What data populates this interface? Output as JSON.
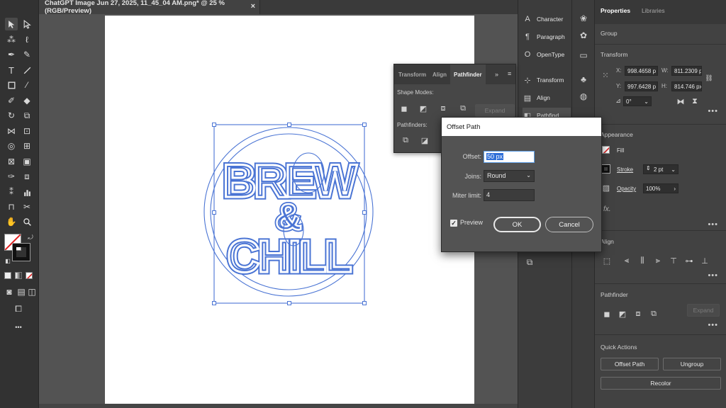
{
  "document": {
    "tab_title": "ChatGPT Image Jun 27, 2025, 11_45_04 AM.png* @ 25 % (RGB/Preview)",
    "close_glyph": "×"
  },
  "toolbar": {
    "tools": [
      "selection-tool",
      "direct-selection-tool",
      "magic-wand-tool",
      "lasso-tool",
      "pen-tool",
      "curvature-tool",
      "type-tool",
      "line-tool",
      "rectangle-tool",
      "paintbrush-tool",
      "shaper-tool",
      "eraser-tool",
      "rotate-tool",
      "scale-tool",
      "width-tool",
      "free-transform-tool",
      "shape-builder-tool",
      "perspective-grid-tool",
      "mesh-tool",
      "gradient-tool",
      "eyedropper-tool",
      "blend-tool",
      "symbol-sprayer-tool",
      "column-graph-tool",
      "artboard-tool",
      "slice-tool",
      "hand-tool",
      "zoom-tool"
    ],
    "more_glyph": "•••"
  },
  "mid_dock": {
    "items": [
      "Character",
      "Paragraph",
      "OpenType",
      "Transform",
      "Align",
      "Pathfind..."
    ]
  },
  "properties": {
    "tabs": [
      "Properties",
      "Libraries"
    ],
    "selection_type": "Group",
    "transform": {
      "title": "Transform",
      "x_label": "X:",
      "x": "998.4658 p",
      "y_label": "Y:",
      "y": "997.6428 p",
      "w_label": "W:",
      "w": "811.2309 p",
      "h_label": "H:",
      "h": "814.746 px",
      "angle": "0°"
    },
    "appearance": {
      "title": "Appearance",
      "fill_label": "Fill",
      "stroke_label": "Stroke",
      "stroke_weight": "2 pt",
      "opacity_label": "Opacity",
      "opacity": "100%",
      "fx": "fx."
    },
    "align": {
      "title": "Align"
    },
    "pathfinder": {
      "title": "Pathfinder",
      "expand_label": "Expand"
    },
    "quick_actions": {
      "title": "Quick Actions",
      "offset_path": "Offset Path",
      "ungroup": "Ungroup",
      "recolor": "Recolor"
    },
    "more_glyph": "•••"
  },
  "pathfinder_panel": {
    "tabs": [
      "Transform",
      "Align",
      "Pathfinder"
    ],
    "shape_modes_label": "Shape Modes:",
    "pathfinders_label": "Pathfinders:",
    "expand_label": "Expand"
  },
  "offset_dialog": {
    "title": "Offset Path",
    "offset_label": "Offset:",
    "offset_value": "50 px",
    "joins_label": "Joins:",
    "joins_value": "Round",
    "miter_label": "Miter limit:",
    "miter_value": "4",
    "preview_label": "Preview",
    "preview_checked": true,
    "ok_label": "OK",
    "cancel_label": "Cancel"
  },
  "artwork": {
    "line1": "BREW",
    "ampersand": "&",
    "line2": "CHILL",
    "outline_color": "#4a74d4"
  }
}
